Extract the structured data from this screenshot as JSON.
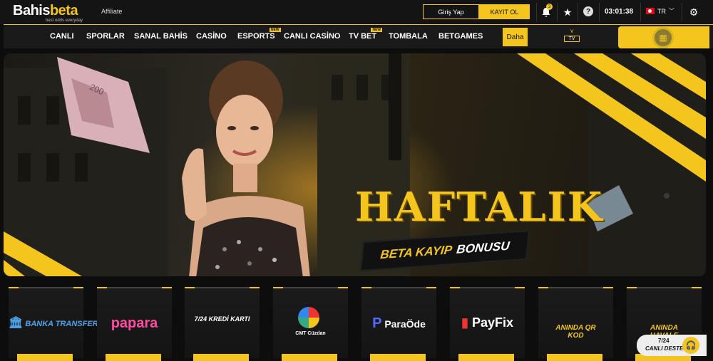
{
  "header": {
    "brand_part1": "Bahis",
    "brand_part2": "beta",
    "slogan": "best odds everyday",
    "affiliate": "Affiliate",
    "login_label": "Giriş Yap",
    "register_label": "KAYIT OL",
    "notification_count": "3",
    "clock": "03:01:38",
    "language": "TR"
  },
  "nav": {
    "items": [
      {
        "label": "CANLI"
      },
      {
        "label": "SPORLAR"
      },
      {
        "label": "SANAL BAHİS"
      },
      {
        "label": "CASİNO"
      },
      {
        "label": "ESPORTS",
        "badge": "NEW"
      },
      {
        "label": "CANLI CASİNO"
      },
      {
        "label": "TV BET",
        "badge": "NEW"
      },
      {
        "label": "TOMBALA"
      },
      {
        "label": "BETGAMES"
      }
    ],
    "more_label": "Daha",
    "tv_label": "TV"
  },
  "banner": {
    "headline": "HAFTALIK",
    "sub_part1": "BETA KAYIP",
    "sub_part2": "BONUSU",
    "slide_count": 10,
    "active_slide": 9
  },
  "payments": [
    {
      "name": "BANKA TRANSFERİ",
      "color": "#4fa3e8"
    },
    {
      "name": "papara",
      "color": "#ff4aa0"
    },
    {
      "name": "7/24 KREDİ KARTI",
      "color": "#4fa3e8"
    },
    {
      "name": "CMT Cüzdan",
      "color": "#ffffff"
    },
    {
      "name": "ParaÖde",
      "color": "#ffffff"
    },
    {
      "name": "PayFix",
      "color": "#ffffff"
    },
    {
      "name": "ANINDA QR KOD",
      "color": "#f3c51d"
    },
    {
      "name": "ANINDA HAVALE",
      "color": "#f3c51d"
    }
  ],
  "chat": {
    "line1": "7/24",
    "line2": "CANLI DESTEK"
  },
  "colors": {
    "accent": "#f3c51d",
    "background": "#0d0d0d"
  }
}
